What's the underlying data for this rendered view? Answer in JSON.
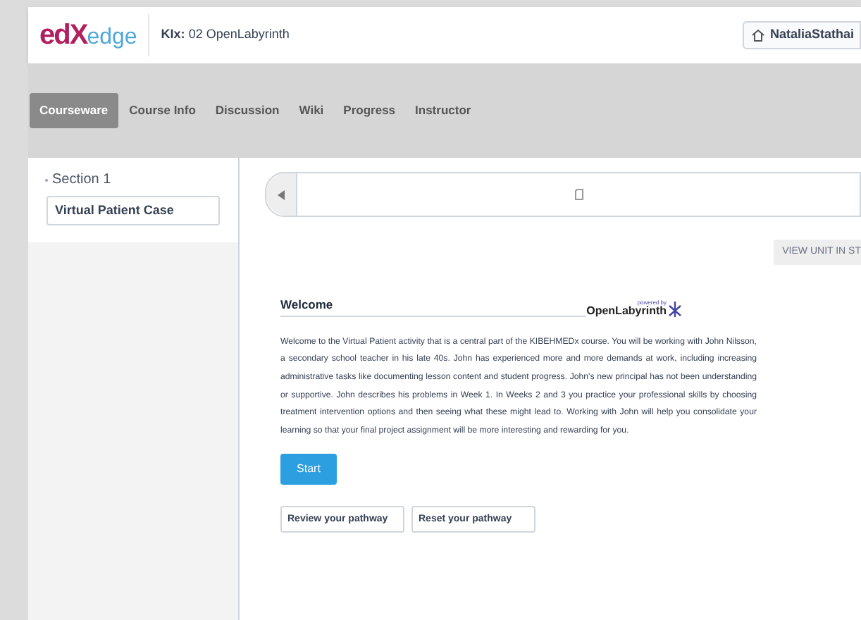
{
  "logo": {
    "mark": "edX",
    "word": "edge"
  },
  "course": {
    "code": "KIx:",
    "name": "02 OpenLabyrinth"
  },
  "user": {
    "name": "NataliaStathai"
  },
  "tabs": [
    {
      "label": "Courseware",
      "selected": true
    },
    {
      "label": "Course Info",
      "selected": false
    },
    {
      "label": "Discussion",
      "selected": false
    },
    {
      "label": "Wiki",
      "selected": false
    },
    {
      "label": "Progress",
      "selected": false
    },
    {
      "label": "Instructor",
      "selected": false
    }
  ],
  "sidebar": {
    "section": "Section 1",
    "items": [
      {
        "label": "Virtual Patient Case",
        "selected": true
      }
    ]
  },
  "view_unit": "VIEW UNIT IN ST",
  "activity": {
    "title": "Welcome",
    "brand_small": "powered by",
    "brand": "OpenLabyrinth",
    "body": "Welcome to the Virtual Patient activity that is a central part of the KIBEHMEDx course. You will be working with John Nilsson, a secondary school teacher in his late 40s. John has experienced more and more demands at work, including increasing administrative tasks like documenting lesson content and student progress. John's new principal has not been understanding or supportive. John describes his problems in Week 1. In Weeks 2 and 3 you practice your professional skills by choosing treatment intervention options and then seeing what these might lead to. Working with John will help you consolidate your learning so that your final project assignment will be more interesting and rewarding for you.",
    "start": "Start",
    "buttons": [
      "Review your pathway",
      "Reset your pathway"
    ]
  }
}
